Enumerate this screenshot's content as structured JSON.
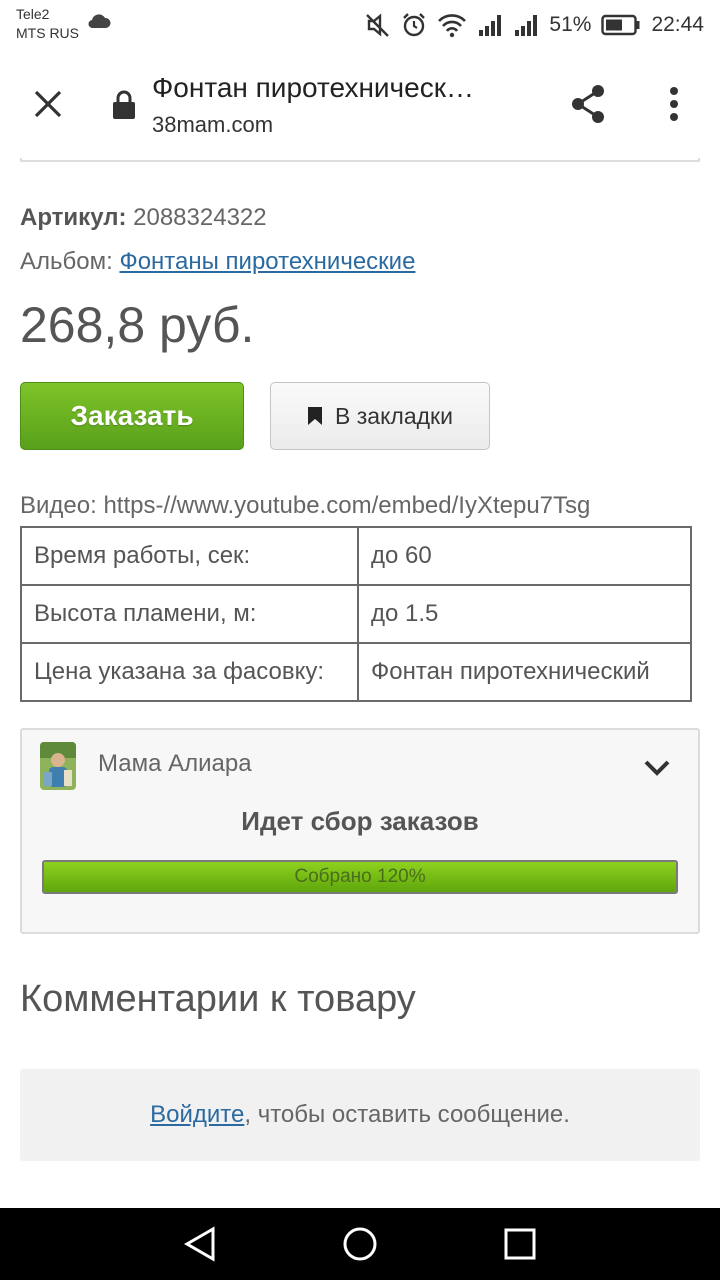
{
  "status_bar": {
    "carrier_line1": "Tele2",
    "carrier_line2": "MTS RUS",
    "battery": "51%",
    "time": "22:44"
  },
  "app_bar": {
    "title": "Фонтан пиротехническ…",
    "domain": "38mam.com"
  },
  "product": {
    "article_label": "Артикул:",
    "article_value": "2088324322",
    "album_label": "Альбом:",
    "album_link": "Фонтаны пиротехнические",
    "price": "268,8 руб.",
    "order_button": "Заказать",
    "bookmark_button": "В закладки",
    "video_text": "Видео: https-//www.youtube.com/embed/IyXtepu7Tsg"
  },
  "properties": [
    {
      "key": "Время работы, сек:",
      "value": "до 60"
    },
    {
      "key": "Высота пламени, м:",
      "value": "до 1.5"
    },
    {
      "key": "Цена указана за фасовку:",
      "value": "Фонтан пиротехнический"
    }
  ],
  "seller": {
    "name": "Мама Алиара",
    "status_title": "Идет сбор заказов",
    "progress_label": "Собрано 120%",
    "progress_fraction": 1.0
  },
  "comments": {
    "title": "Комментарии к товару",
    "login_link": "Войдите",
    "login_rest": ", чтобы оставить сообщение."
  },
  "colors": {
    "accent_green": "#6cb320",
    "link_blue": "#2b6aa0"
  }
}
